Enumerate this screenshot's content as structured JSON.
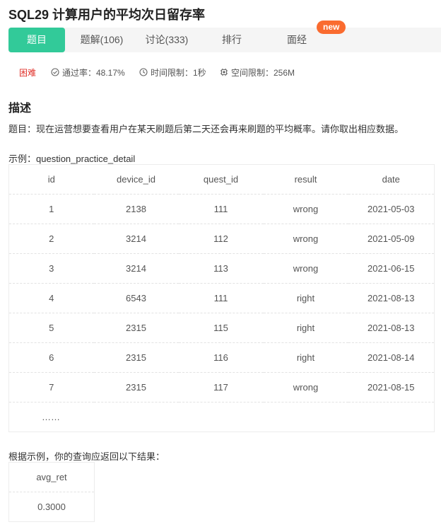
{
  "problem": {
    "title": "SQL29  计算用户的平均次日留存率"
  },
  "tabs": [
    {
      "label": "题目"
    },
    {
      "label": "题解(106)"
    },
    {
      "label": "讨论(333)"
    },
    {
      "label": "排行"
    },
    {
      "label": "面经"
    }
  ],
  "new_badge": "new",
  "meta": {
    "difficulty": "困难",
    "pass_rate": "通过率：48.17%",
    "time_limit": "时间限制：1秒",
    "space_limit": "空间限制：256M"
  },
  "description": {
    "heading": "描述",
    "text": "题目：现在运营想要查看用户在某天刷题后第二天还会再来刷题的平均概率。请你取出相应数据。",
    "example_label": "示例：question_practice_detail",
    "result_label": "根据示例，你的查询应返回以下结果："
  },
  "sample_table": {
    "headers": [
      "id",
      "device_id",
      "quest_id",
      "result",
      "date"
    ],
    "rows": [
      [
        "1",
        "2138",
        "111",
        "wrong",
        "2021-05-03"
      ],
      [
        "2",
        "3214",
        "112",
        "wrong",
        "2021-05-09"
      ],
      [
        "3",
        "3214",
        "113",
        "wrong",
        "2021-06-15"
      ],
      [
        "4",
        "6543",
        "111",
        "right",
        "2021-08-13"
      ],
      [
        "5",
        "2315",
        "115",
        "right",
        "2021-08-13"
      ],
      [
        "6",
        "2315",
        "116",
        "right",
        "2021-08-14"
      ],
      [
        "7",
        "2315",
        "117",
        "wrong",
        "2021-08-15"
      ]
    ],
    "ellipsis": "……"
  },
  "result_table": {
    "header": "avg_ret",
    "value": "0.3000"
  },
  "icons": {
    "pass_rate": "check-circle-icon",
    "time_limit": "clock-icon",
    "space_limit": "memory-chip-icon"
  },
  "colors": {
    "accent": "#32ca99",
    "badge": "#fa6b2f",
    "difficulty": "#e0322b"
  }
}
